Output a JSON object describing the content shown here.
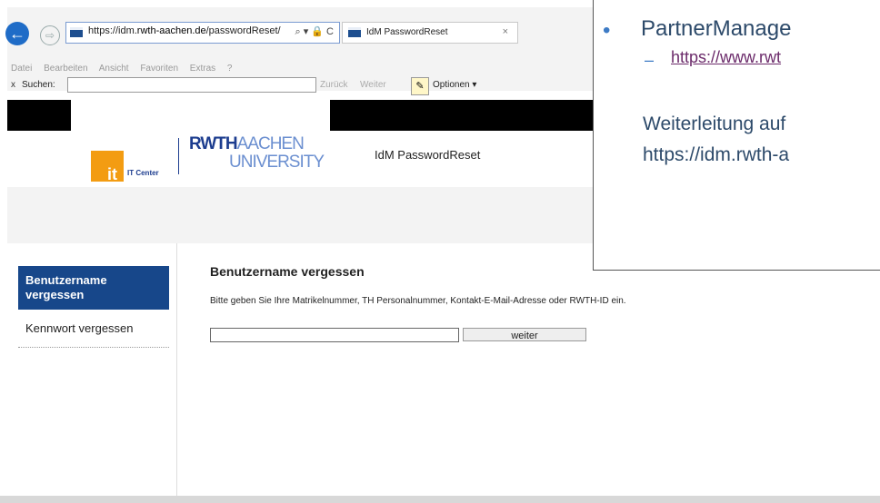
{
  "browser": {
    "url_prefix": "https://idm.",
    "url_domain": "rwth-aachen.de",
    "url_path": "/passwordReset/",
    "address_tools": "⌕ ▾ 🔒 C",
    "tab_title": "IdM PasswordReset",
    "tab_close": "×",
    "menu": [
      "Datei",
      "Bearbeiten",
      "Ansicht",
      "Favoriten",
      "Extras",
      "?"
    ],
    "search_close": "x",
    "search_label": "Suchen:",
    "search_value": "",
    "find_back": "Zurück",
    "find_next": "Weiter",
    "options_label": "Optionen ▾"
  },
  "header": {
    "it_logo_text": "it",
    "it_center": "IT Center",
    "rwth_bold": "RWTH",
    "rwth_light": "AACHEN",
    "university": "UNIVERSITY",
    "app_title": "IdM PasswordReset"
  },
  "sidebar": {
    "items": [
      {
        "label": "Benutzername vergessen"
      },
      {
        "label": "Kennwort vergessen"
      }
    ]
  },
  "main": {
    "heading": "Benutzername vergessen",
    "description": "Bitte geben Sie Ihre Matrikelnummer, TH Personalnummer, Kontakt-E-Mail-Adresse oder RWTH-ID ein.",
    "input_value": "",
    "button_label": "weiter"
  },
  "overlay": {
    "bullet": "•",
    "title": "PartnerManage",
    "dash": "–",
    "link": "https://www.rwt",
    "redirect": "Weiterleitung auf",
    "redirect_url": "https://idm.rwth-a"
  },
  "colors": {
    "accent": "#17478a",
    "logo_orange": "#f39c12",
    "browser_blue": "#1f6cc7"
  }
}
